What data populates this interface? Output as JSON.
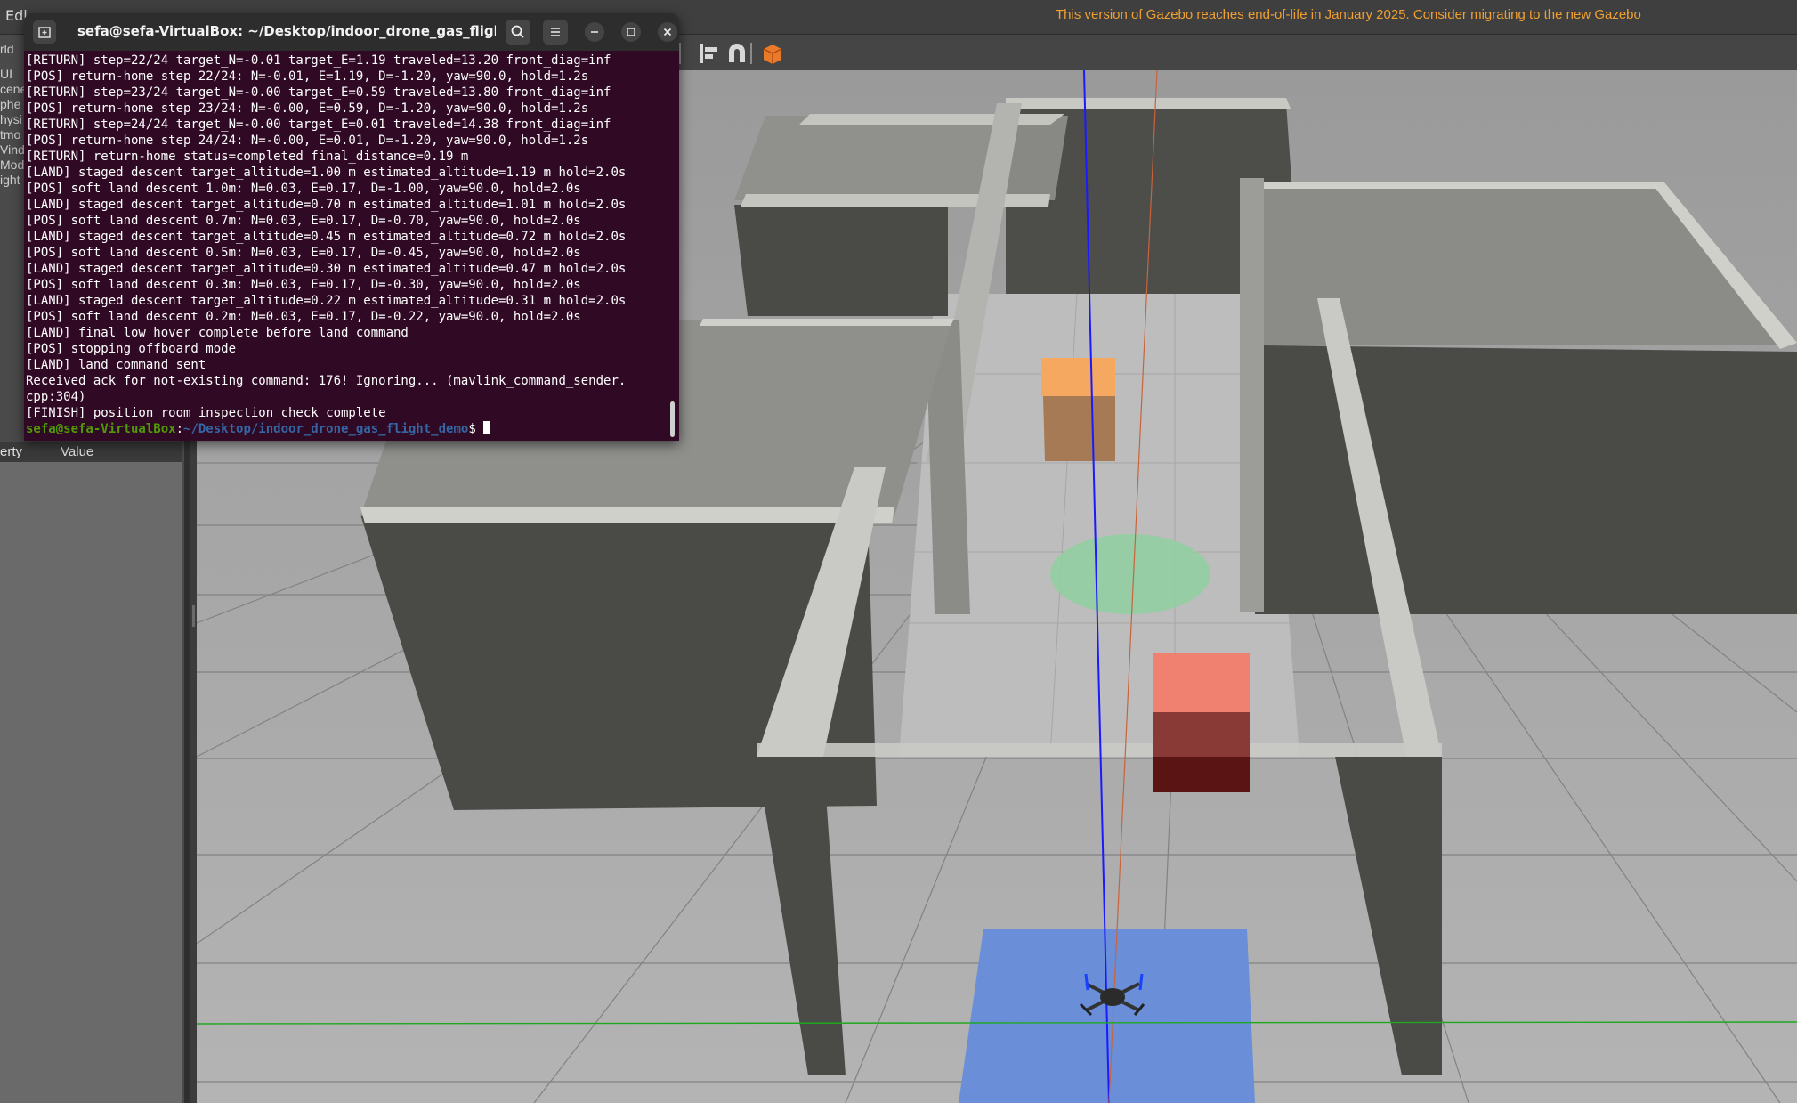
{
  "gazebo": {
    "menu_edit": "Edi",
    "notice_text": "This version of Gazebo reaches end-of-life in January 2025. Consider ",
    "notice_link": "migrating to the new Gazebo",
    "tree_items": [
      "rld",
      "UI",
      "cene",
      "phe",
      "hysi",
      "tmo",
      "Vind",
      "Mode",
      "ight"
    ],
    "property_col": "erty",
    "value_col": "Value"
  },
  "terminal": {
    "title": "sefa@sefa-VirtualBox: ~/Desktop/indoor_drone_gas_flight_...",
    "lines": [
      "[RETURN] step=22/24 target_N=-0.01 target_E=1.19 traveled=13.20 front_diag=inf",
      "[POS] return-home step 22/24: N=-0.01, E=1.19, D=-1.20, yaw=90.0, hold=1.2s",
      "[RETURN] step=23/24 target_N=-0.00 target_E=0.59 traveled=13.80 front_diag=inf",
      "[POS] return-home step 23/24: N=-0.00, E=0.59, D=-1.20, yaw=90.0, hold=1.2s",
      "[RETURN] step=24/24 target_N=-0.00 target_E=0.01 traveled=14.38 front_diag=inf",
      "[POS] return-home step 24/24: N=-0.00, E=0.01, D=-1.20, yaw=90.0, hold=1.2s",
      "[RETURN] return-home status=completed final_distance=0.19 m",
      "[LAND] staged descent target_altitude=1.00 m estimated_altitude=1.19 m hold=2.0s",
      "[POS] soft land descent 1.0m: N=0.03, E=0.17, D=-1.00, yaw=90.0, hold=2.0s",
      "[LAND] staged descent target_altitude=0.70 m estimated_altitude=1.01 m hold=2.0s",
      "[POS] soft land descent 0.7m: N=0.03, E=0.17, D=-0.70, yaw=90.0, hold=2.0s",
      "[LAND] staged descent target_altitude=0.45 m estimated_altitude=0.72 m hold=2.0s",
      "[POS] soft land descent 0.5m: N=0.03, E=0.17, D=-0.45, yaw=90.0, hold=2.0s",
      "[LAND] staged descent target_altitude=0.30 m estimated_altitude=0.47 m hold=2.0s",
      "[POS] soft land descent 0.3m: N=0.03, E=0.17, D=-0.30, yaw=90.0, hold=2.0s",
      "[LAND] staged descent target_altitude=0.22 m estimated_altitude=0.31 m hold=2.0s",
      "[POS] soft land descent 0.2m: N=0.03, E=0.17, D=-0.22, yaw=90.0, hold=2.0s",
      "[LAND] final low hover complete before land command",
      "[POS] stopping offboard mode",
      "[LAND] land command sent",
      "Received ack for not-existing command: 176! Ignoring... (mavlink_command_sender.",
      "cpp:304)",
      "[FINISH] position room inspection check complete"
    ],
    "prompt_user": "sefa@sefa-VirtualBox",
    "prompt_sep": ":",
    "prompt_path": "~/Desktop/indoor_drone_gas_flight_demo",
    "prompt_symbol": "$ "
  },
  "colors": {
    "terminal_bg": "#300a24",
    "notice": "#f0a030",
    "orange_box": "#f5a860",
    "red_box": "#f08070",
    "green_zone": "#90d0a0",
    "blue_pad": "#6a8fd8"
  },
  "icons": [
    "new-tab-icon",
    "search-icon",
    "hamburger-menu-icon",
    "minimize-icon",
    "maximize-icon",
    "close-icon",
    "align-tool-icon",
    "snap-magnet-icon",
    "orange-cube-icon"
  ]
}
